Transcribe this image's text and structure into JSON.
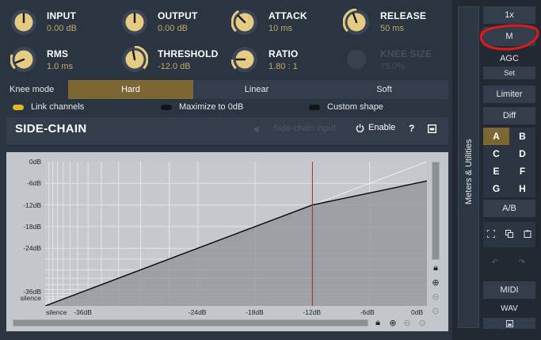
{
  "knobs": [
    {
      "label": "INPUT",
      "value": "0.00 dB"
    },
    {
      "label": "OUTPUT",
      "value": "0.00 dB"
    },
    {
      "label": "ATTACK",
      "value": "10 ms"
    },
    {
      "label": "RELEASE",
      "value": "50 ms"
    },
    {
      "label": "RMS",
      "value": "1.0 ms"
    },
    {
      "label": "THRESHOLD",
      "value": "-12.0 dB"
    },
    {
      "label": "RATIO",
      "value": "1.80 : 1"
    },
    {
      "label": "KNEE SIZE",
      "value": "75.0%"
    }
  ],
  "knee": {
    "label": "Knee mode",
    "options": [
      "Hard",
      "Linear",
      "Soft"
    ],
    "selected": "Hard"
  },
  "options": {
    "link_channels": "Link channels",
    "maximize": "Maximize to 0dB",
    "custom_shape": "Custom shape"
  },
  "sidechain": {
    "title": "SIDE-CHAIN",
    "input_label": "Side-chain input",
    "enable_label": "Enable",
    "help_icon": "?",
    "collapse_icon": "collapse-icon"
  },
  "graph": {
    "y_ticks": [
      "0dB",
      "-6dB",
      "-12dB",
      "-18dB",
      "-24dB",
      "-36dB",
      "silence"
    ],
    "x_ticks": [
      "silence",
      "-36dB",
      "-24dB",
      "-18dB",
      "-12dB",
      "-6dB",
      "0dB"
    ],
    "threshold_db": -12,
    "ratio": 1.8,
    "colors": {
      "curve": "#111111",
      "threshold_line": "#b52525",
      "fill": "#8e9296"
    }
  },
  "right_panel": {
    "vertical_tab": "Meters & Utilities",
    "scale_btn": "1x",
    "m_btn": "M",
    "agc_label": "AGC",
    "set_btn": "Set",
    "limiter_btn": "Limiter",
    "diff_btn": "Diff",
    "presets": [
      "A",
      "B",
      "C",
      "D",
      "E",
      "F",
      "G",
      "H"
    ],
    "active_preset": "A",
    "ab_btn": "A/B",
    "midi_btn": "MIDI",
    "wav_label": "WAV",
    "annotation_color": "#e01a1a"
  }
}
